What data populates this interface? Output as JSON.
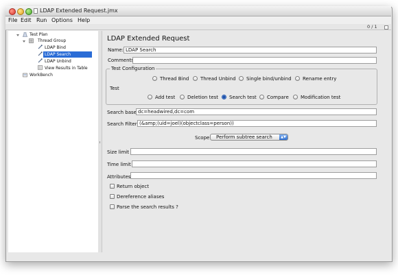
{
  "window": {
    "title": "LDAP Extended Request.jmx"
  },
  "menu": [
    "File",
    "Edit",
    "Run",
    "Options",
    "Help"
  ],
  "toolbar": {
    "counter": "0 / 1"
  },
  "tree": {
    "test_plan": "Test Plan",
    "thread_group": "Thread Group",
    "ldap_bind": "LDAP Bind",
    "ldap_search": "LDAP Search",
    "ldap_unbind": "LDAP Unbind",
    "view_results": "View Results in Table",
    "workbench": "WorkBench"
  },
  "panel": {
    "title": "LDAP Extended Request",
    "name_label": "Name:",
    "name_value": "LDAP Search",
    "comments_label": "Comments",
    "comments_value": "",
    "test_config_title": "Test Configuration",
    "test_label": "Test",
    "radios": {
      "thread_bind": "Thread Bind",
      "thread_unbind": "Thread Unbind",
      "single_bind": "Single bind/unbind",
      "rename_entry": "Rename entry",
      "add_test": "Add test",
      "deletion_test": "Deletion test",
      "search_test": "Search test",
      "compare": "Compare",
      "modification_test": "Modification test"
    },
    "selected_test": "Search test",
    "search_base_label": "Search base",
    "search_base_value": "dc=headwired,dc=com",
    "search_filter_label": "Search Filter",
    "search_filter_value": "(&amp;(uid=joel)(objectclass=person))",
    "scope_label": "Scope",
    "scope_value": "Perform subtree search",
    "size_limit_label": "Size limit",
    "size_limit_value": "",
    "time_limit_label": "Time limit",
    "time_limit_value": "",
    "attributes_label": "Attributes",
    "attributes_value": "",
    "checkboxes": {
      "return_object": "Return object",
      "dereference_aliases": "Dereference aliases",
      "parse_results": "Parse the search results ?"
    }
  },
  "colors": {
    "selection": "#2a6cd6",
    "panel_bg": "#e8e8e8"
  }
}
